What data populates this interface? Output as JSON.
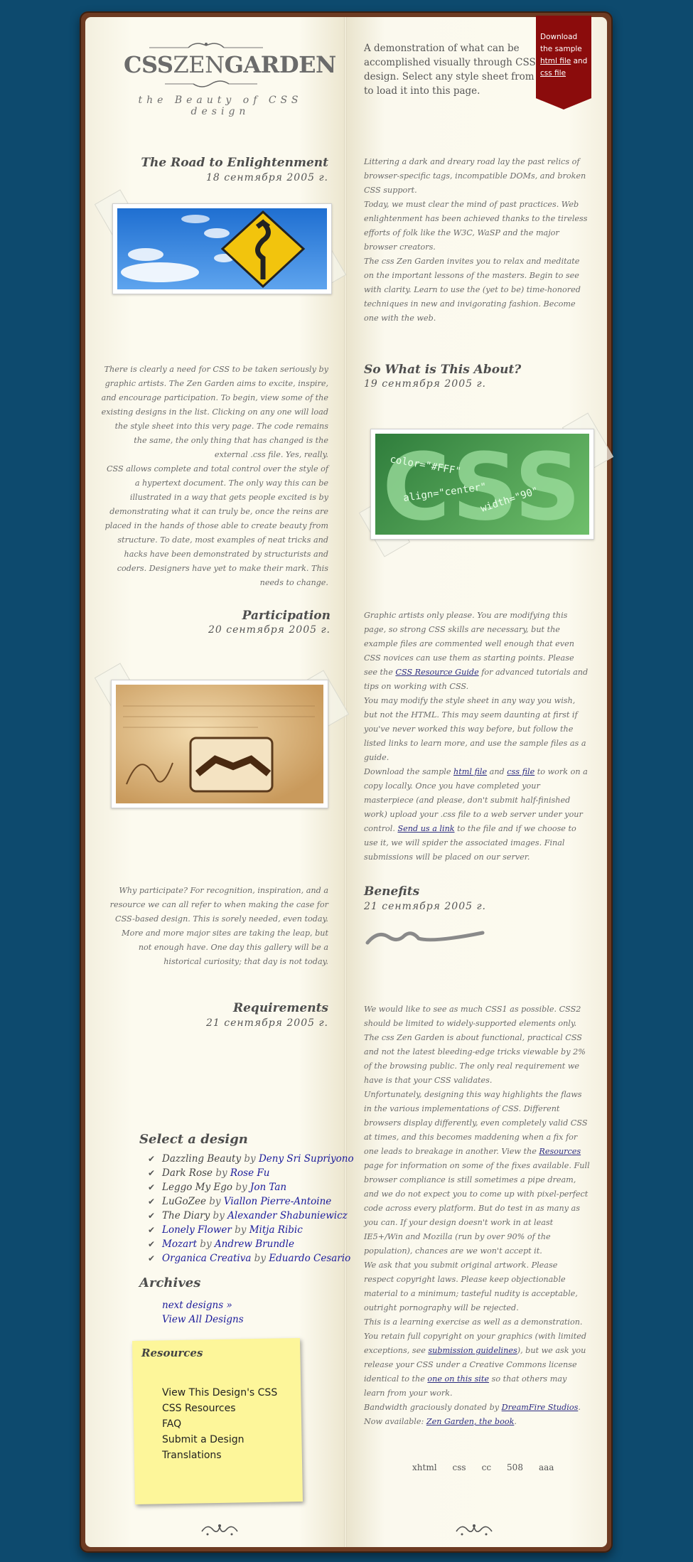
{
  "logo": {
    "title_bold_1": "CSS",
    "title_thin": "ZEN",
    "title_bold_2": "GARDEN",
    "tagline": "the Beauty of CSS design"
  },
  "intro": "A demonstration of what can be accomplished visually through CSS-based design. Select any style sheet from the list to load it into this page.",
  "ribbon": {
    "text_1": "Download the sample ",
    "html_link": "html file",
    "text_2": " and ",
    "css_link": "css file"
  },
  "sections": {
    "road": {
      "heading": "The Road to Enlightenment",
      "date": "18 сентября 2005 г."
    },
    "about": {
      "heading": "So What is This About?",
      "date": "19 сентября 2005 г."
    },
    "participation": {
      "heading": "Participation",
      "date": "20 сентября 2005 г."
    },
    "benefits": {
      "heading": "Benefits",
      "date": "21 сентября 2005 г."
    },
    "requirements": {
      "heading": "Requirements",
      "date": "21 сентября 2005 г."
    }
  },
  "road_text": [
    "Littering a dark and dreary road lay the past relics of browser-specific tags, incompatible DOMs, and broken CSS support.",
    "Today, we must clear the mind of past practices. Web enlightenment has been achieved thanks to the tireless efforts of folk like the W3C, WaSP and the major browser creators.",
    "The css Zen Garden invites you to relax and meditate on the important lessons of the masters. Begin to see with clarity. Learn to use the (yet to be) time-honored techniques in new and invigorating fashion. Become one with the web."
  ],
  "about_text": [
    "There is clearly a need for CSS to be taken seriously by graphic artists. The Zen Garden aims to excite, inspire, and encourage participation. To begin, view some of the existing designs in the list. Clicking on any one will load the style sheet into this very page. The code remains the same, the only thing that has changed is the external .css file. Yes, really.",
    "CSS allows complete and total control over the style of a hypertext document. The only way this can be illustrated in a way that gets people excited is by demonstrating what it can truly be, once the reins are placed in the hands of those able to create beauty from structure. To date, most examples of neat tricks and hacks have been demonstrated by structurists and coders. Designers have yet to make their mark. This needs to change."
  ],
  "participation_text": {
    "p1_start": "Graphic artists only please. You are modifying this page, so strong CSS skills are necessary, but the example files are commented well enough that even CSS novices can use them as starting points. Please see the ",
    "p1_link": "CSS Resource Guide",
    "p1_end": " for advanced tutorials and tips on working with CSS.",
    "p2_start": "You may modify the style sheet in any way you wish, but not the HTML. This may seem daunting at first if you've never worked this way before, but follow the listed links to learn more, and use the sample files as a guide.",
    "p3_a": "Download the sample ",
    "p3_html": "html file",
    "p3_b": " and ",
    "p3_css": "css file",
    "p3_c": " to work on a copy locally. Once you have completed your masterpiece (and please, don't submit half-finished work) upload your .css file to a web server under your control. ",
    "p3_send": "Send us a link",
    "p3_d": " to the file and if we choose to use it, we will spider the associated images. Final submissions will be placed on our server."
  },
  "benefits_text": "Why participate? For recognition, inspiration, and a resource we can all refer to when making the case for CSS-based design. This is sorely needed, even today. More and more major sites are taking the leap, but not enough have. One day this gallery will be a historical curiosity; that day is not today.",
  "requirements_text": {
    "p1": "We would like to see as much CSS1 as possible. CSS2 should be limited to widely-supported elements only. The css Zen Garden is about functional, practical CSS and not the latest bleeding-edge tricks viewable by 2% of the browsing public. The only real requirement we have is that your CSS validates.",
    "p2_a": "Unfortunately, designing this way highlights the flaws in the various implementations of CSS. Different browsers display differently, even completely valid CSS at times, and this becomes maddening when a fix for one leads to breakage in another. View the ",
    "p2_link": "Resources",
    "p2_b": " page for information on some of the fixes available. Full browser compliance is still sometimes a pipe dream, and we do not expect you to come up with pixel-perfect code across every platform. But do test in as many as you can. If your design doesn't work in at least IE5+/Win and Mozilla (run by over 90% of the population), chances are we won't accept it.",
    "p3": "We ask that you submit original artwork. Please respect copyright laws. Please keep objectionable material to a minimum; tasteful nudity is acceptable, outright pornography will be rejected.",
    "p4_a": "This is a learning exercise as well as a demonstration. You retain full copyright on your graphics (with limited exceptions, see ",
    "p4_link1": "submission guidelines",
    "p4_b": "), but we ask you release your CSS under a Creative Commons license identical to the ",
    "p4_link2": "one on this site",
    "p4_c": " so that others may learn from your work.",
    "p5_a": "Bandwidth graciously donated by ",
    "p5_link": "DreamFire Studios",
    "p5_b": ".",
    "p6_a": "Now available: ",
    "p6_link": "Zen Garden, the book",
    "p6_b": "."
  },
  "select_design": {
    "title": "Select a design",
    "by": "by",
    "items": [
      {
        "design": "Dazzling Beauty",
        "author": "Deny Sri Supriyono"
      },
      {
        "design": "Dark Rose",
        "author": "Rose Fu"
      },
      {
        "design": "Leggo My Ego",
        "author": "Jon Tan"
      },
      {
        "design": "LuGoZee",
        "author": "Viallon Pierre-Antoine"
      },
      {
        "design": "The Diary",
        "author": "Alexander Shabuniewicz"
      },
      {
        "design": "Lonely Flower",
        "author": "Mitja Ribic"
      },
      {
        "design": "Mozart",
        "author": "Andrew Brundle"
      },
      {
        "design": "Organica Creativa",
        "author": "Eduardo Cesario"
      }
    ]
  },
  "archives": {
    "title": "Archives",
    "next": "next designs »",
    "all": "View All Designs"
  },
  "resources": {
    "title": "Resources",
    "items": [
      "View This Design's CSS",
      "CSS Resources",
      "FAQ",
      "Submit a Design",
      "Translations"
    ]
  },
  "footer": [
    "xhtml",
    "css",
    "cc",
    "508",
    "aaa"
  ],
  "colors": {
    "background": "#0d4a6e",
    "ribbon": "#8b0c0c",
    "sticky": "#fdf69a",
    "link": "#1a1a9a"
  }
}
